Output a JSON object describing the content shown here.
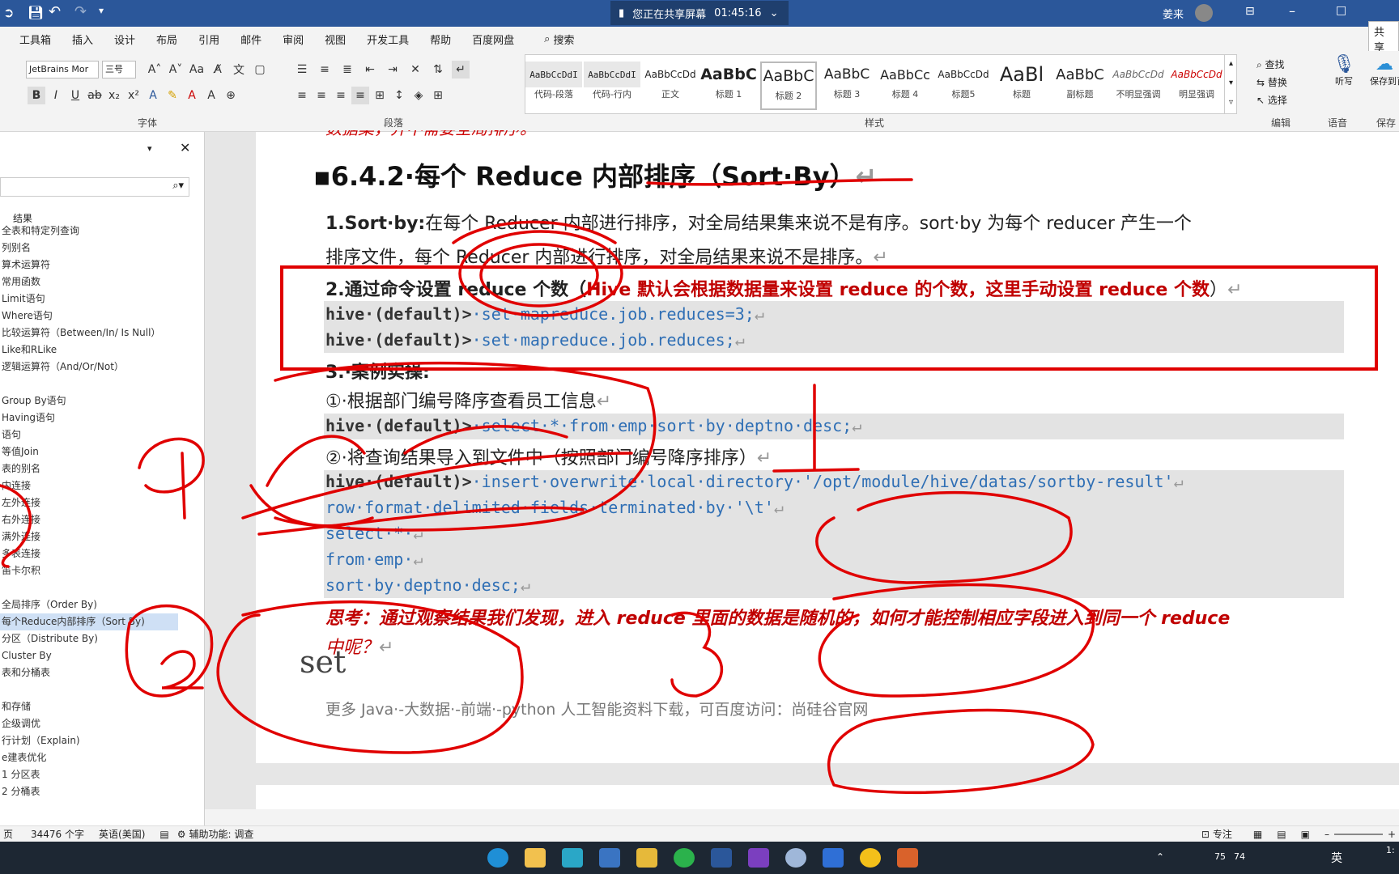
{
  "title_bar": {
    "share_status": "您正在共享屏幕",
    "share_timer": "01:45:16",
    "user_name": "姜来"
  },
  "menu": {
    "items": [
      "工具箱",
      "插入",
      "设计",
      "布局",
      "引用",
      "邮件",
      "审阅",
      "视图",
      "开发工具",
      "帮助",
      "百度网盘"
    ],
    "search_label": "搜索",
    "share_label": "共享"
  },
  "ribbon": {
    "font_name": "JetBrains Mor",
    "font_size": "三号",
    "group_font": "字体",
    "group_paragraph": "段落",
    "group_styles": "样式",
    "group_edit": "编辑",
    "group_voice": "语音",
    "group_save": "保存",
    "edit_find": "查找",
    "edit_replace": "替换",
    "edit_select": "选择",
    "voice_dictate": "听写",
    "save_label": "保存到百度网盘",
    "styles": [
      {
        "preview": "AaBbCcDdI",
        "name": "代码-段落"
      },
      {
        "preview": "AaBbCcDdI",
        "name": "代码-行内"
      },
      {
        "preview": "AaBbCcDd",
        "name": "正文"
      },
      {
        "preview": "AaBbC",
        "name": "标题 1"
      },
      {
        "preview": "AaBbC",
        "name": "标题 2"
      },
      {
        "preview": "AaBbC",
        "name": "标题 3"
      },
      {
        "preview": "AaBbCc",
        "name": "标题 4"
      },
      {
        "preview": "AaBbCcDd",
        "name": "标题5"
      },
      {
        "preview": "AaBl",
        "name": "标题"
      },
      {
        "preview": "AaBbC",
        "name": "副标题"
      },
      {
        "preview": "AaBbCcDd",
        "name": "不明显强调"
      },
      {
        "preview": "AaBbCcDd",
        "name": "明显强调"
      }
    ]
  },
  "nav": {
    "results_label": "结果",
    "items": [
      "全表和特定列查询",
      "列别名",
      "算术运算符",
      "常用函数",
      "Limit语句",
      "Where语句",
      "比较运算符（Between/In/ Is Null）",
      "Like和RLike",
      "逻辑运算符（And/Or/Not）",
      "",
      "Group By语句",
      "Having语句",
      "语句",
      "等值Join",
      "表的别名",
      "内连接",
      "左外连接",
      "右外连接",
      "满外连接",
      "多表连接",
      "笛卡尔积",
      "",
      "全局排序（Order By)",
      "每个Reduce内部排序（Sort By)",
      "分区（Distribute By)",
      "Cluster By",
      "表和分桶表",
      "",
      "和存储",
      "企级调优",
      "行计划（Explain)",
      "e建表优化",
      "1 分区表",
      "2 分桶表"
    ],
    "selected_index": 23
  },
  "document": {
    "top_cut": "数据集，并不需要全局排序。",
    "heading": "6.4.2·每个 Reduce 内部排序（Sort·By）",
    "p1_label": "1.Sort·by:",
    "p1_text": "在每个 Reducer 内部进行排序，对全局结果集来说不是有序。sort·by 为每个 reducer 产生一个",
    "p1_text2": "排序文件，每个 Reducer 内部进行排序，对全局结果来说不是排序。",
    "p2_label": "2.通过命令设置 reduce 个数（",
    "p2_red": "Hive 默认会根据数据量来设置 reduce 的个数，这里手动设置 reduce 个数",
    "p2_end": "）",
    "code1_prompt": "hive·(default)>",
    "code1_cmd": "·set·mapreduce.job.reduces=3;",
    "code2_prompt": "hive·(default)>",
    "code2_cmd": "·set·mapreduce.job.reduces;",
    "p3": "3.·案例实操:",
    "p4": "①·根据部门编号降序查看员工信息",
    "code3_prompt": "hive·(default)>",
    "code3_cmd": "·select·*·from·emp·sort·by·deptno·desc;",
    "p5": "②·将查询结果导入到文件中（按照部门编号降序排序）",
    "code4_prompt": "hive·(default)>",
    "code4_cmd": "·insert·overwrite·local·directory·'/opt/module/hive/datas/sortby-result'",
    "code5": "row·format·delimited·fields·terminated·by·'\\t'",
    "code6": "select·*·",
    "code7": "from·emp·",
    "code8": "sort·by·deptno·desc;",
    "think1": "思考：通过观察结果我们发现，进入 reduce 里面的数据是随机的，如何才能控制相应字段进入到同一个 reduce",
    "think2": "中呢？",
    "annotation_text": "set",
    "footer": "更多 Java·-大数据·-前端·-python 人工智能资料下载，可百度访问：尚硅谷官网"
  },
  "status": {
    "page": "页",
    "word_count": "34476 个字",
    "language": "英语(美国)",
    "accessibility": "辅助功能: 调查",
    "focus": "专注"
  },
  "taskbar": {
    "tray_text1": "75",
    "tray_text2": "74",
    "ime": "英",
    "clock": "1:"
  },
  "colors": {
    "accent": "#2b579a",
    "annotation_red": "#e00000",
    "code_blue": "#2f6fb5",
    "think_red": "#c00000"
  }
}
